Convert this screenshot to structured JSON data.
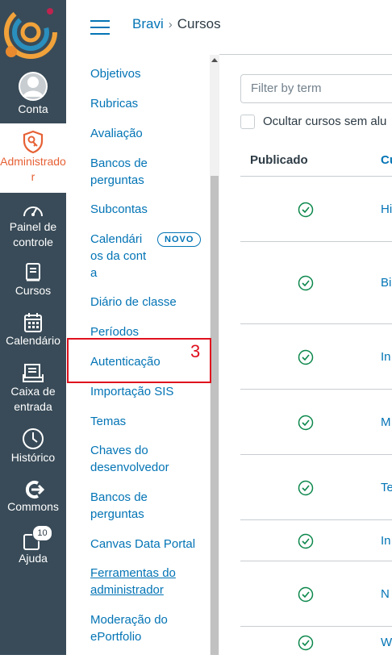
{
  "global_nav": {
    "items": [
      {
        "label": "Conta"
      },
      {
        "label": "Administrado r"
      },
      {
        "label": "Painel de controle"
      },
      {
        "label": "Cursos"
      },
      {
        "label": "Calendário"
      },
      {
        "label": "Caixa de entrada"
      },
      {
        "label": "Histórico"
      },
      {
        "label": "Commons"
      },
      {
        "label": "Ajuda",
        "badge": "10"
      }
    ],
    "colors": {
      "background": "#394b58",
      "active_text": "#e66135"
    }
  },
  "breadcrumb": {
    "account": "Bravi",
    "current": "Cursos"
  },
  "sub_nav": {
    "items": [
      {
        "label": "Objetivos"
      },
      {
        "label": "Rubricas"
      },
      {
        "label": "Avaliação"
      },
      {
        "label": "Bancos de perguntas"
      },
      {
        "label": "Subcontas"
      },
      {
        "label": "Calendári os da conta",
        "pill": "NOVO"
      },
      {
        "label": "Diário de classe"
      },
      {
        "label": "Períodos"
      },
      {
        "label": "Autenticação"
      },
      {
        "label": "Importação SIS"
      },
      {
        "label": "Temas"
      },
      {
        "label": "Chaves do desenvolvedor"
      },
      {
        "label": "Bancos de perguntas"
      },
      {
        "label": "Canvas Data Portal"
      },
      {
        "label": "Ferramentas do administrador"
      },
      {
        "label": "Moderação do ePortfolio"
      }
    ]
  },
  "annotation": {
    "number": "3",
    "color": "#e0101e"
  },
  "main": {
    "filter_placeholder": "Filter by term",
    "hide_label": "Ocultar cursos sem alu",
    "columns": [
      "Publicado",
      "Cu"
    ],
    "rows": [
      {
        "course": "Hi"
      },
      {
        "course": "Bi"
      },
      {
        "course": "In"
      },
      {
        "course": "M"
      },
      {
        "course": "Te"
      },
      {
        "course": "In"
      },
      {
        "course": "N"
      },
      {
        "course": "W"
      }
    ],
    "accent": "#0374b5",
    "published_color": "#0b874b"
  }
}
